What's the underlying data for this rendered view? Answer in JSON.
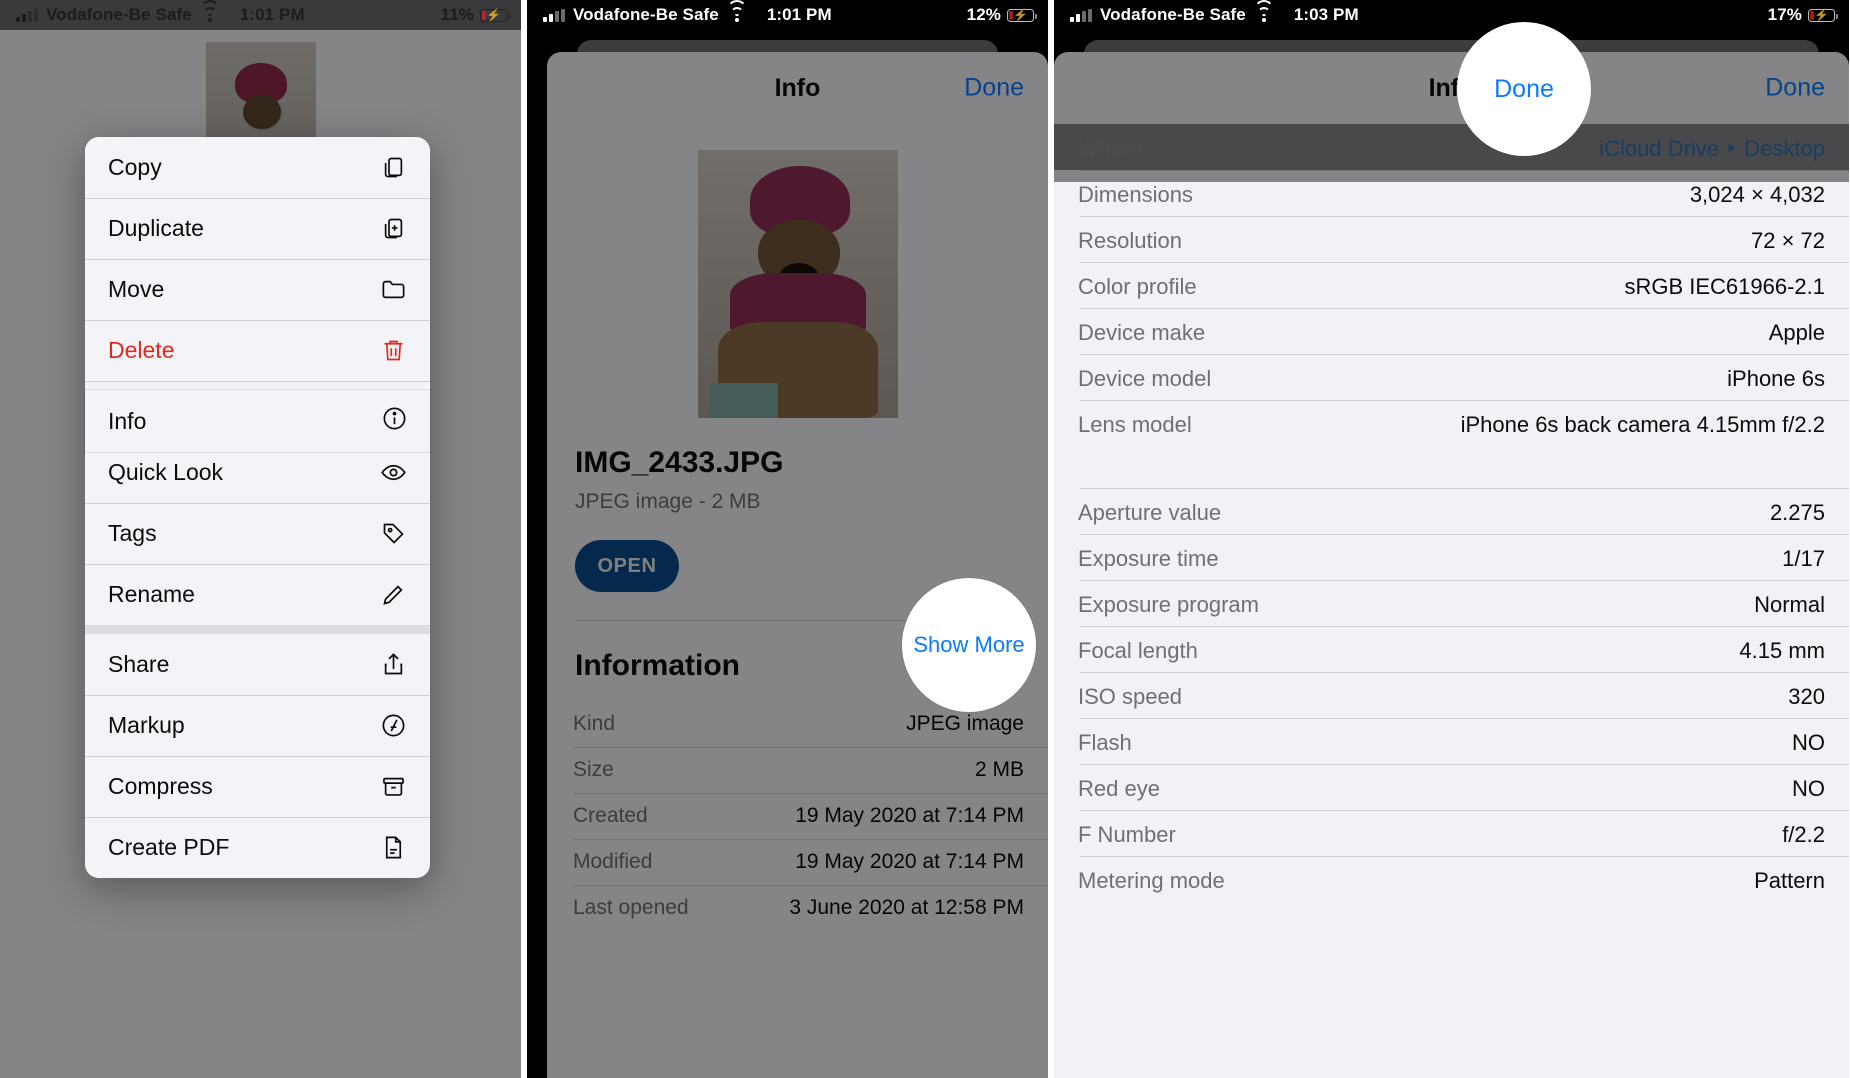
{
  "panels": [
    {
      "status": {
        "carrier": "Vodafone-Be Safe",
        "time": "1:01 PM",
        "battery": "11%",
        "wifi_icon": "wifi-icon",
        "signal_icon": "cellular-signal-icon",
        "battery_icon": "battery-charging-icon"
      },
      "context_menu": {
        "items": [
          {
            "label": "Copy",
            "icon": "copy-icon"
          },
          {
            "label": "Duplicate",
            "icon": "duplicate-icon"
          },
          {
            "label": "Move",
            "icon": "folder-icon"
          },
          {
            "label": "Delete",
            "icon": "trash-icon"
          },
          {
            "label": "Info",
            "icon": "info-circle-icon"
          },
          {
            "label": "Quick Look",
            "icon": "eye-icon"
          },
          {
            "label": "Tags",
            "icon": "tag-icon"
          },
          {
            "label": "Rename",
            "icon": "pencil-icon"
          },
          {
            "label": "Share",
            "icon": "share-icon"
          },
          {
            "label": "Markup",
            "icon": "markup-icon"
          },
          {
            "label": "Compress",
            "icon": "archive-box-icon"
          },
          {
            "label": "Create PDF",
            "icon": "document-icon"
          }
        ],
        "highlighted": "Info"
      }
    },
    {
      "status": {
        "carrier": "Vodafone-Be Safe",
        "time": "1:01 PM",
        "battery": "12%",
        "wifi_icon": "wifi-icon",
        "signal_icon": "cellular-signal-icon",
        "battery_icon": "battery-charging-icon"
      },
      "nav": {
        "title": "Info",
        "done": "Done"
      },
      "file": {
        "name": "IMG_2433.JPG",
        "meta": "JPEG image - 2 MB",
        "open_label": "OPEN",
        "preview_icon": "photo-thumbnail"
      },
      "section_title": "Information",
      "rows": [
        {
          "key": "Kind",
          "value": "JPEG image"
        },
        {
          "key": "Size",
          "value": "2 MB"
        },
        {
          "key": "Created",
          "value": "19 May 2020 at 7:14 PM"
        },
        {
          "key": "Modified",
          "value": "19 May 2020 at 7:14 PM"
        },
        {
          "key": "Last opened",
          "value": "3 June 2020 at 12:58 PM"
        }
      ],
      "spotlight": {
        "label": "Show More"
      }
    },
    {
      "status": {
        "carrier": "Vodafone-Be Safe",
        "time": "1:03 PM",
        "battery": "17%",
        "wifi_icon": "wifi-icon",
        "signal_icon": "cellular-signal-icon",
        "battery_icon": "battery-charging-icon"
      },
      "nav": {
        "title": "Info",
        "done": "Done"
      },
      "rows": [
        {
          "key": "Where",
          "value": "iCloud Drive ‣ Desktop",
          "link": true,
          "dimmed": true
        },
        {
          "key": "Dimensions",
          "value": "3,024 × 4,032"
        },
        {
          "key": "Resolution",
          "value": "72 × 72"
        },
        {
          "key": "Color profile",
          "value": "sRGB IEC61966-2.1"
        },
        {
          "key": "Device make",
          "value": "Apple"
        },
        {
          "key": "Device model",
          "value": "iPhone 6s"
        },
        {
          "key": "Lens model",
          "value": "iPhone 6s back camera 4.15mm f/2.2"
        },
        {
          "key": "Aperture value",
          "value": "2.275"
        },
        {
          "key": "Exposure time",
          "value": "1/17"
        },
        {
          "key": "Exposure program",
          "value": "Normal"
        },
        {
          "key": "Focal length",
          "value": "4.15 mm"
        },
        {
          "key": "ISO speed",
          "value": "320"
        },
        {
          "key": "Flash",
          "value": "NO"
        },
        {
          "key": "Red eye",
          "value": "NO"
        },
        {
          "key": "F Number",
          "value": "f/2.2"
        },
        {
          "key": "Metering mode",
          "value": "Pattern"
        }
      ],
      "spotlight": {
        "label": "Done"
      }
    }
  ],
  "colors": {
    "accent_blue": "#0a7aff",
    "destructive_red": "#e02a20",
    "open_button": "#0a4b8c",
    "sheet_bg": "#f2f1f6"
  }
}
